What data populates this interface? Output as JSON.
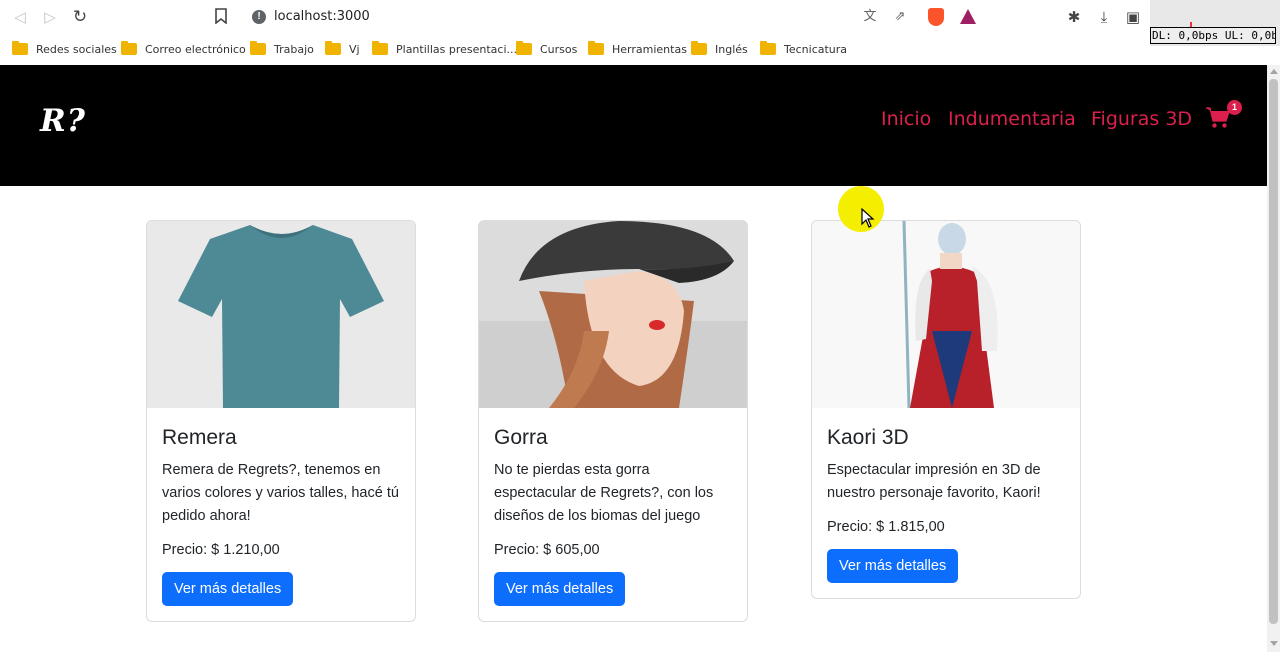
{
  "browser": {
    "url": "localhost:3000",
    "netmeter": "DL: 0,0bps UL: 0,0bps",
    "bookmarks": [
      {
        "label": "Redes sociales"
      },
      {
        "label": "Correo electrónico"
      },
      {
        "label": "Trabajo"
      },
      {
        "label": "Vj"
      },
      {
        "label": "Plantillas presentaci..."
      },
      {
        "label": "Cursos"
      },
      {
        "label": "Herramientas"
      },
      {
        "label": "Inglés"
      },
      {
        "label": "Tecnicatura"
      }
    ]
  },
  "site": {
    "logo": "R?",
    "nav": [
      {
        "label": "Inicio"
      },
      {
        "label": "Indumentaria"
      },
      {
        "label": "Figuras 3D"
      }
    ],
    "cart_count": "1",
    "colors": {
      "accent": "#dc1f4c",
      "navbar": "#000000",
      "button": "#0d6efd"
    }
  },
  "products": [
    {
      "title": "Remera",
      "description": "Remera de Regrets?, tenemos en varios colores y varios talles, hacé tú pedido ahora!",
      "price": "Precio: $ 1.210,00",
      "button": "Ver más detalles",
      "image": "teal-tshirt"
    },
    {
      "title": "Gorra",
      "description": "No te pierdas esta gorra espectacular de Regrets?, con los diseños de los biomas del juego",
      "price": "Precio: $ 605,00",
      "button": "Ver más detalles",
      "image": "woman-in-cap"
    },
    {
      "title": "Kaori 3D",
      "description": "Espectacular impresión en 3D de nuestro personaje favorito, Kaori!",
      "price": "Precio: $ 1.815,00",
      "button": "Ver más detalles",
      "image": "anime-figure"
    }
  ]
}
